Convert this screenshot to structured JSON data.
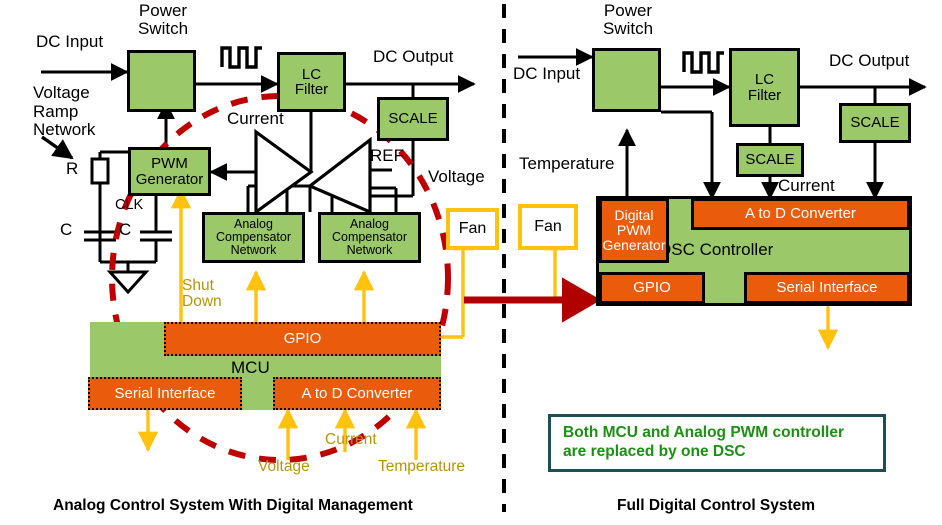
{
  "colors": {
    "green_block": "#9bc869",
    "orange_block": "#ea5b0c",
    "yellow_arrow": "#ffc20e",
    "fan_border": "#ffc20e",
    "red_dashed": "#c00000",
    "red_arrow": "#b00000",
    "note_border": "#1d4f57",
    "note_text": "#1a9113",
    "yellow_label": "#b8960b"
  },
  "left_panel": {
    "caption": "Analog Control System With Digital Management",
    "labels": {
      "dc_input": "DC Input",
      "power_switch": "Power\nSwitch",
      "dc_output": "DC Output",
      "voltage_ramp_network": "Voltage\nRamp\nNetwork",
      "r": "R",
      "c1": "C",
      "c2": "C",
      "clk": "CLK",
      "current_amp": "Current",
      "ref": "REF",
      "voltage_scale": "Voltage",
      "shut_down": "Shut\nDown",
      "mcu": "MCU",
      "adc_voltage": "Voltage",
      "adc_current": "Current",
      "adc_temperature": "Temperature"
    },
    "blocks": [
      {
        "name": "power-switch",
        "label": ""
      },
      {
        "name": "lc-filter",
        "label": "LC\nFilter"
      },
      {
        "name": "scale",
        "label": "SCALE"
      },
      {
        "name": "pwm-generator",
        "label": "PWM\nGenerator"
      },
      {
        "name": "analog-compensator-network-1",
        "label": "Analog\nCompensator\nNetwork"
      },
      {
        "name": "analog-compensator-network-2",
        "label": "Analog\nCompensator\nNetwork"
      },
      {
        "name": "fan",
        "label": "Fan"
      }
    ],
    "mcu_peripherals": [
      {
        "name": "gpio",
        "label": "GPIO"
      },
      {
        "name": "serial-interface",
        "label": "Serial Interface"
      },
      {
        "name": "a-to-d-converter",
        "label": "A to D Converter"
      }
    ]
  },
  "right_panel": {
    "caption": "Full Digital Control System",
    "labels": {
      "dc_input": "DC Input",
      "power_switch": "Power\nSwitch",
      "dc_output": "DC Output",
      "temperature": "Temperature",
      "current": "Current",
      "dsc_controller": "DSC Controller"
    },
    "blocks": [
      {
        "name": "power-switch",
        "label": ""
      },
      {
        "name": "lc-filter",
        "label": "LC\nFilter"
      },
      {
        "name": "scale-output",
        "label": "SCALE"
      },
      {
        "name": "scale-current",
        "label": "SCALE"
      },
      {
        "name": "fan",
        "label": "Fan"
      }
    ],
    "dsc_peripherals": [
      {
        "name": "digital-pwm-generator",
        "label": "Digital\nPWM\nGenerator"
      },
      {
        "name": "a-to-d-converter",
        "label": "A to D Converter"
      },
      {
        "name": "gpio",
        "label": "GPIO"
      },
      {
        "name": "serial-interface",
        "label": "Serial Interface"
      }
    ],
    "note": {
      "line1": "Both MCU and Analog PWM controller",
      "line2": "are replaced by one DSC"
    }
  }
}
